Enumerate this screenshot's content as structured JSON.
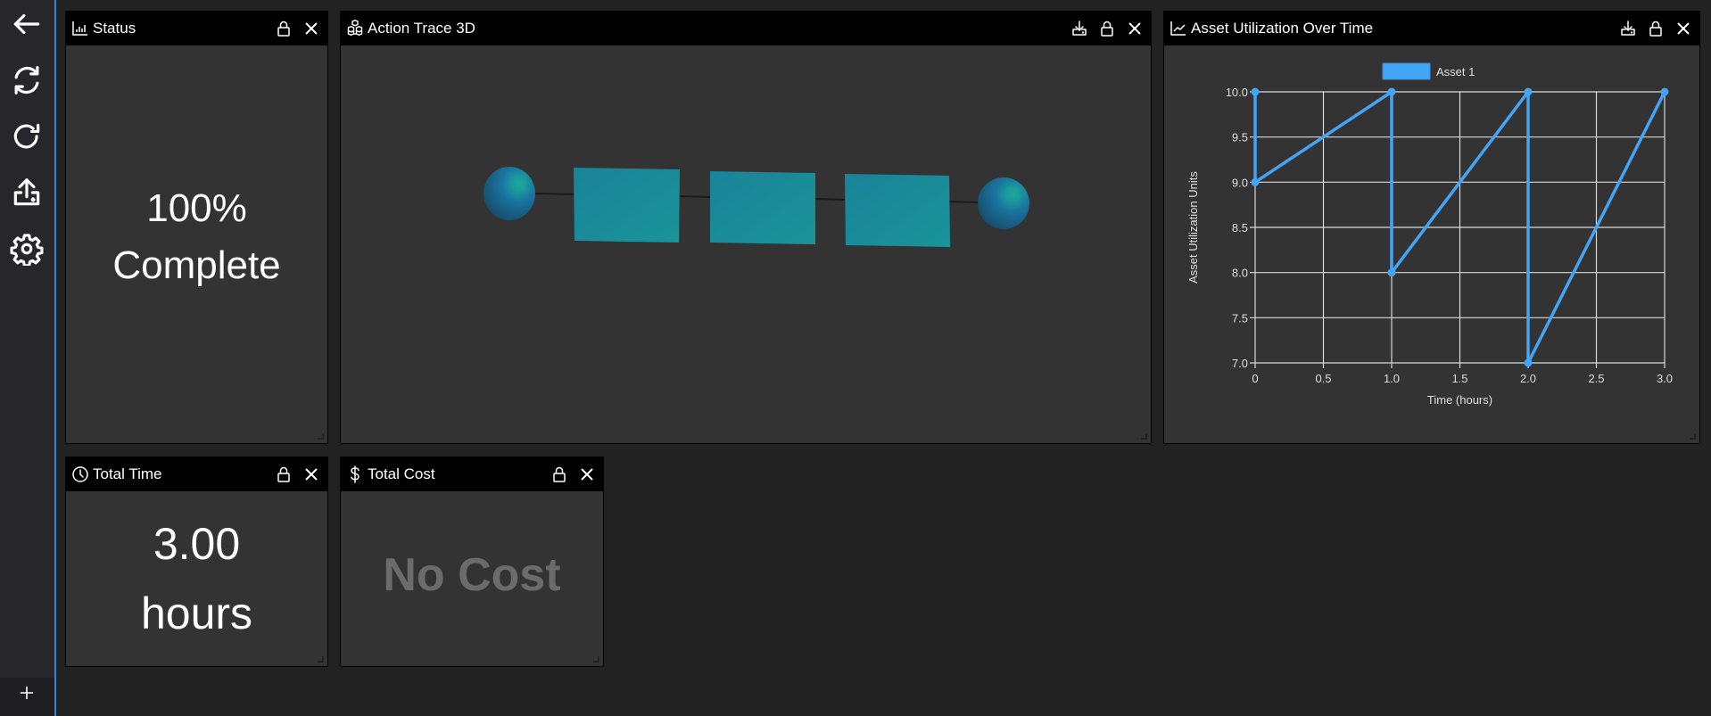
{
  "sidebar": {
    "items": [
      {
        "name": "back",
        "icon": "arrow-left-icon"
      },
      {
        "name": "sync",
        "icon": "sync-icon"
      },
      {
        "name": "redo",
        "icon": "rotate-cw-icon"
      },
      {
        "name": "upload",
        "icon": "upload-icon"
      },
      {
        "name": "settings",
        "icon": "gear-icon"
      }
    ],
    "add_label": "+"
  },
  "panels": {
    "status": {
      "title": "Status",
      "icon": "bar-chart-icon",
      "line1": "100%",
      "line2": "Complete",
      "progress_percent": 100
    },
    "trace3d": {
      "title": "Action Trace 3D",
      "icon": "boxes-icon",
      "scene": {
        "nodes": [
          "sphere",
          "box",
          "box",
          "box",
          "sphere"
        ],
        "colors": {
          "sphere": "#1c6e9a",
          "sphere_highlight": "#1aa39a",
          "box": "#1a8a9a",
          "edge": "#1a1a1a"
        }
      }
    },
    "asset_util": {
      "title": "Asset Utilization Over Time",
      "icon": "line-chart-icon"
    },
    "total_time": {
      "title": "Total Time",
      "icon": "clock-icon",
      "line1": "3.00",
      "line2": "hours"
    },
    "total_cost": {
      "title": "Total Cost",
      "icon": "dollar-icon",
      "text": "No Cost"
    }
  },
  "colors": {
    "accent": "#3b7ddd",
    "series": "#42a5f5",
    "panel_bg": "#333333",
    "header_bg": "#000000",
    "page_bg": "#222222"
  },
  "chart_data": {
    "type": "line",
    "title": "",
    "xlabel": "Time (hours)",
    "ylabel": "Asset Utilization Units",
    "xlim": [
      0,
      3
    ],
    "ylim": [
      7,
      10
    ],
    "xticks": [
      "0",
      "0.5",
      "1.0",
      "1.5",
      "2.0",
      "2.5",
      "3.0"
    ],
    "xtick_values": [
      0,
      0.5,
      1,
      1.5,
      2,
      2.5,
      3
    ],
    "yticks": [
      "7.0",
      "7.5",
      "8.0",
      "8.5",
      "9.0",
      "9.5",
      "10.0"
    ],
    "ytick_values": [
      7,
      7.5,
      8,
      8.5,
      9,
      9.5,
      10
    ],
    "grid": true,
    "legend": "top-center",
    "series": [
      {
        "name": "Asset 1",
        "color": "#42a5f5",
        "points": [
          [
            0,
            10
          ],
          [
            0,
            9
          ],
          [
            1,
            10
          ],
          [
            1,
            8
          ],
          [
            2,
            10
          ],
          [
            2,
            7
          ],
          [
            3,
            10
          ]
        ]
      }
    ]
  }
}
